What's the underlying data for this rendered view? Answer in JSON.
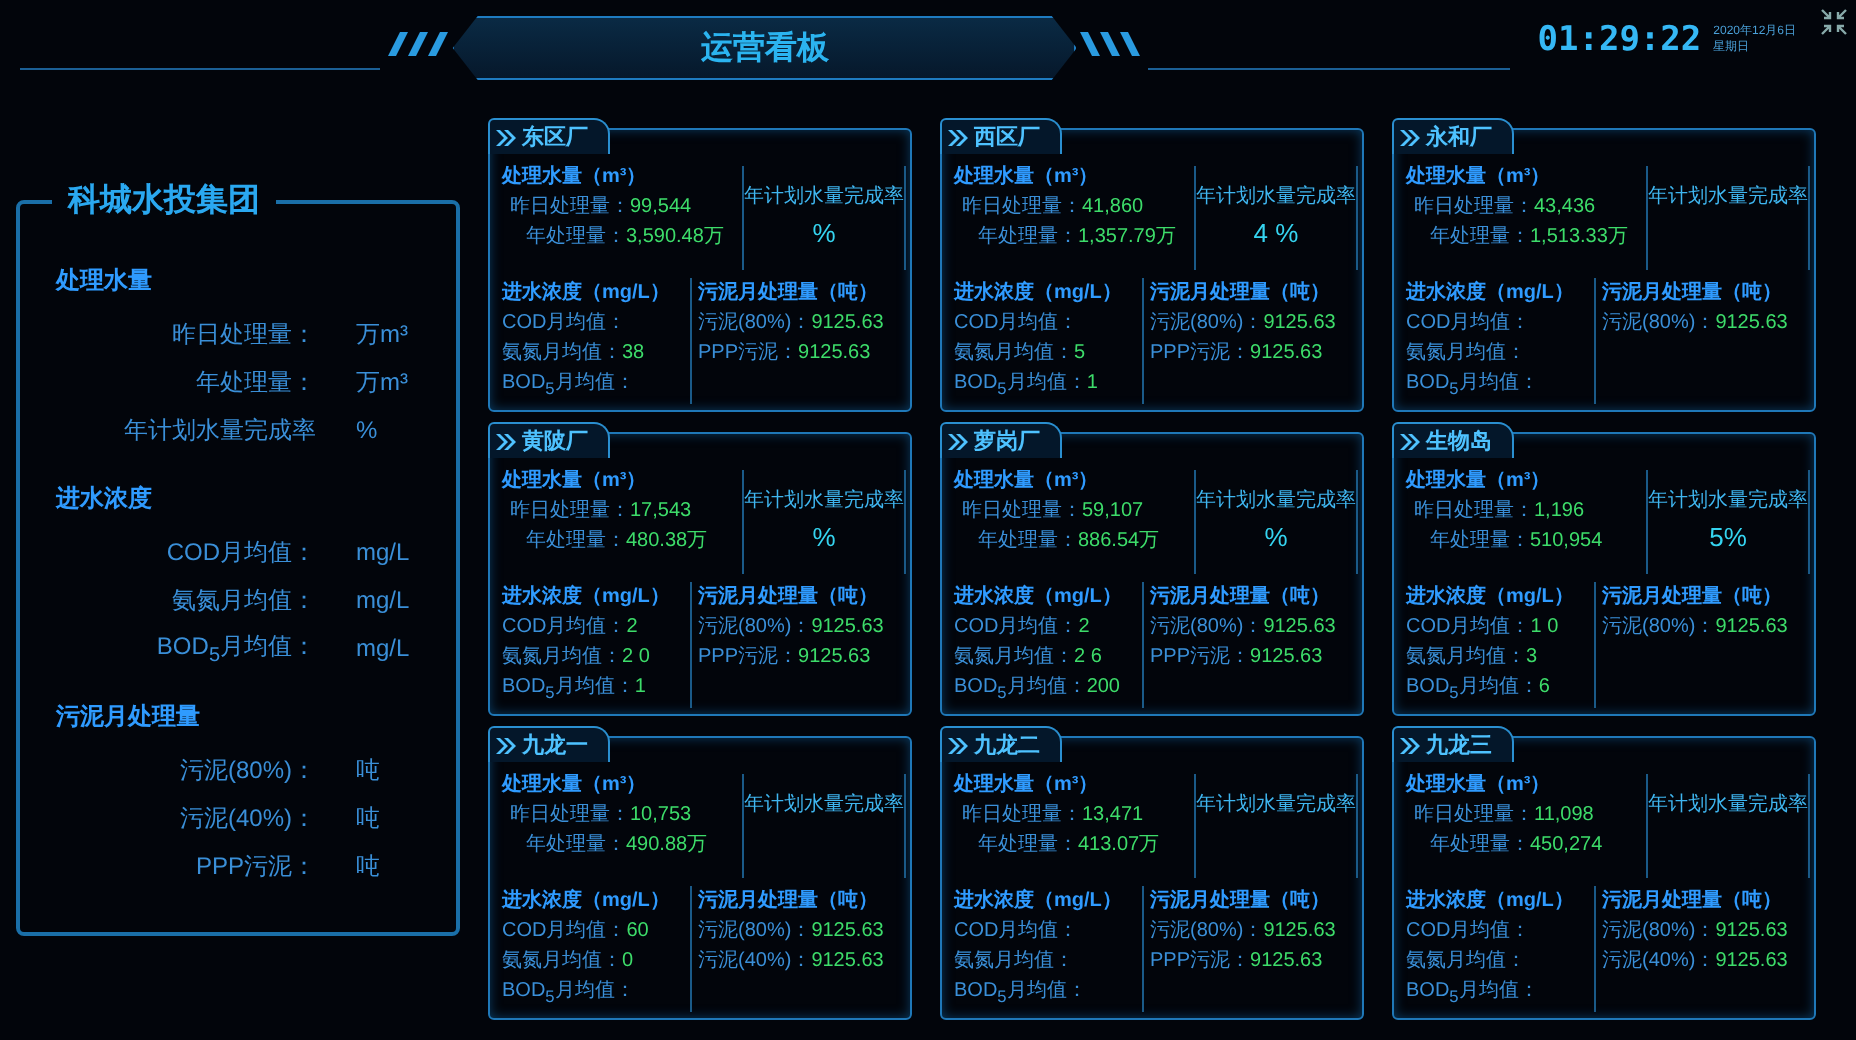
{
  "header": {
    "title": "运营看板",
    "clock": "01:29:22",
    "date": "2020年12月6日",
    "weekday": "星期日"
  },
  "summary": {
    "title": "科城水投集团",
    "sections": [
      {
        "heading": "处理水量",
        "rows": [
          {
            "label": "昨日处理量：",
            "unit": "万m³"
          },
          {
            "label": "年处理量：",
            "unit": "万m³"
          },
          {
            "label": "年计划水量完成率",
            "unit": "%"
          }
        ]
      },
      {
        "heading": "进水浓度",
        "rows": [
          {
            "label": "COD月均值：",
            "unit": "mg/L"
          },
          {
            "label": "氨氮月均值：",
            "unit": "mg/L"
          },
          {
            "label": "BOD$_{5}$月均值：",
            "unit": "mg/L"
          }
        ]
      },
      {
        "heading": "污泥月处理量",
        "rows": [
          {
            "label": "污泥(80%)：",
            "unit": "吨"
          },
          {
            "label": "污泥(40%)：",
            "unit": "吨"
          },
          {
            "label": "PPP污泥：",
            "unit": "吨"
          }
        ]
      }
    ]
  },
  "plants": [
    {
      "name": "东区厂",
      "water": {
        "heading": "处理水量（m³）",
        "rows": [
          {
            "label": "昨日处理量：",
            "value": "99,544"
          },
          {
            "label": "年处理量：",
            "value": "3,590.48万"
          }
        ]
      },
      "rate": {
        "label": "年计划水量完成率",
        "value": "%"
      },
      "conc": {
        "heading": "进水浓度（mg/L）",
        "rows": [
          {
            "label": "COD月均值："
          },
          {
            "label": "氨氮月均值：",
            "value": "38"
          },
          {
            "label": "BOD$_{5}$月均值："
          }
        ]
      },
      "sludge": {
        "heading": "污泥月处理量（吨）",
        "rows": [
          {
            "label": "污泥(80%)：",
            "value": "9125.63"
          },
          {
            "label": "PPP污泥：",
            "value": "9125.63"
          }
        ]
      }
    },
    {
      "name": "西区厂",
      "water": {
        "heading": "处理水量（m³）",
        "rows": [
          {
            "label": "昨日处理量：",
            "value": "41,860"
          },
          {
            "label": "年处理量：",
            "value": "1,357.79万"
          }
        ]
      },
      "rate": {
        "label": "年计划水量完成率",
        "value": "4 %"
      },
      "conc": {
        "heading": "进水浓度（mg/L）",
        "rows": [
          {
            "label": "COD月均值："
          },
          {
            "label": "氨氮月均值：",
            "value": "5"
          },
          {
            "label": "BOD$_{5}$月均值：",
            "value": "1"
          }
        ]
      },
      "sludge": {
        "heading": "污泥月处理量（吨）",
        "rows": [
          {
            "label": "污泥(80%)：",
            "value": "9125.63"
          },
          {
            "label": "PPP污泥：",
            "value": "9125.63"
          }
        ]
      }
    },
    {
      "name": "永和厂",
      "water": {
        "heading": "处理水量（m³）",
        "rows": [
          {
            "label": "昨日处理量：",
            "value": "43,436"
          },
          {
            "label": "年处理量：",
            "value": "1,513.33万"
          }
        ]
      },
      "rate": {
        "label": "年计划水量完成率"
      },
      "conc": {
        "heading": "进水浓度（mg/L）",
        "rows": [
          {
            "label": "COD月均值："
          },
          {
            "label": "氨氮月均值："
          },
          {
            "label": "BOD$_{5}$月均值："
          }
        ]
      },
      "sludge": {
        "heading": "污泥月处理量（吨）",
        "rows": [
          {
            "label": "污泥(80%)：",
            "value": "9125.63"
          }
        ]
      }
    },
    {
      "name": "黄陂厂",
      "water": {
        "heading": "处理水量（m³）",
        "rows": [
          {
            "label": "昨日处理量：",
            "value": "17,543"
          },
          {
            "label": "年处理量：",
            "value": "480.38万"
          }
        ]
      },
      "rate": {
        "label": "年计划水量完成率",
        "value": "%"
      },
      "conc": {
        "heading": "进水浓度（mg/L）",
        "rows": [
          {
            "label": "COD月均值：",
            "value": "2"
          },
          {
            "label": "氨氮月均值：",
            "value": "2 0"
          },
          {
            "label": "BOD$_{5}$月均值：",
            "value": "1"
          }
        ]
      },
      "sludge": {
        "heading": "污泥月处理量（吨）",
        "rows": [
          {
            "label": "污泥(80%)：",
            "value": "9125.63"
          },
          {
            "label": "PPP污泥：",
            "value": "9125.63"
          }
        ]
      }
    },
    {
      "name": "萝岗厂",
      "water": {
        "heading": "处理水量（m³）",
        "rows": [
          {
            "label": "昨日处理量：",
            "value": "59,107"
          },
          {
            "label": "年处理量：",
            "value": "886.54万"
          }
        ]
      },
      "rate": {
        "label": "年计划水量完成率",
        "value": "%"
      },
      "conc": {
        "heading": "进水浓度（mg/L）",
        "rows": [
          {
            "label": "COD月均值：",
            "value": "2"
          },
          {
            "label": "氨氮月均值：",
            "value": "2 6"
          },
          {
            "label": "BOD$_{5}$月均值：",
            "value": "200"
          }
        ]
      },
      "sludge": {
        "heading": "污泥月处理量（吨）",
        "rows": [
          {
            "label": "污泥(80%)：",
            "value": "9125.63"
          },
          {
            "label": "PPP污泥：",
            "value": "9125.63"
          }
        ]
      }
    },
    {
      "name": "生物岛",
      "water": {
        "heading": "处理水量（m³）",
        "rows": [
          {
            "label": "昨日处理量：",
            "value": "1,196"
          },
          {
            "label": "年处理量：",
            "value": "510,954"
          }
        ]
      },
      "rate": {
        "label": "年计划水量完成率",
        "value": "5%"
      },
      "conc": {
        "heading": "进水浓度（mg/L）",
        "rows": [
          {
            "label": "COD月均值：",
            "value": "1 0"
          },
          {
            "label": "氨氮月均值：",
            "value": "3"
          },
          {
            "label": "BOD$_{5}$月均值：",
            "value": "6"
          }
        ]
      },
      "sludge": {
        "heading": "污泥月处理量（吨）",
        "rows": [
          {
            "label": "污泥(80%)：",
            "value": "9125.63"
          }
        ]
      }
    },
    {
      "name": "九龙一",
      "water": {
        "heading": "处理水量（m³）",
        "rows": [
          {
            "label": "昨日处理量：",
            "value": "10,753"
          },
          {
            "label": "年处理量：",
            "value": "490.88万"
          }
        ]
      },
      "rate": {
        "label": "年计划水量完成率"
      },
      "conc": {
        "heading": "进水浓度（mg/L）",
        "rows": [
          {
            "label": "COD月均值：",
            "value": "60"
          },
          {
            "label": "氨氮月均值：",
            "value": "0"
          },
          {
            "label": "BOD$_{5}$月均值："
          }
        ]
      },
      "sludge": {
        "heading": "污泥月处理量（吨）",
        "rows": [
          {
            "label": "污泥(80%)：",
            "value": "9125.63"
          },
          {
            "label": "污泥(40%)：",
            "value": "9125.63"
          }
        ]
      }
    },
    {
      "name": "九龙二",
      "water": {
        "heading": "处理水量（m³）",
        "rows": [
          {
            "label": "昨日处理量：",
            "value": "13,471"
          },
          {
            "label": "年处理量：",
            "value": "413.07万"
          }
        ]
      },
      "rate": {
        "label": "年计划水量完成率"
      },
      "conc": {
        "heading": "进水浓度（mg/L）",
        "rows": [
          {
            "label": "COD月均值："
          },
          {
            "label": "氨氮月均值："
          },
          {
            "label": "BOD$_{5}$月均值："
          }
        ]
      },
      "sludge": {
        "heading": "污泥月处理量（吨）",
        "rows": [
          {
            "label": "污泥(80%)：",
            "value": "9125.63"
          },
          {
            "label": "PPP污泥：",
            "value": "9125.63"
          }
        ]
      }
    },
    {
      "name": "九龙三",
      "water": {
        "heading": "处理水量（m³）",
        "rows": [
          {
            "label": "昨日处理量：",
            "value": "11,098"
          },
          {
            "label": "年处理量：",
            "value": "450,274"
          }
        ]
      },
      "rate": {
        "label": "年计划水量完成率"
      },
      "conc": {
        "heading": "进水浓度（mg/L）",
        "rows": [
          {
            "label": "COD月均值："
          },
          {
            "label": "氨氮月均值："
          },
          {
            "label": "BOD$_{5}$月均值："
          }
        ]
      },
      "sludge": {
        "heading": "污泥月处理量（吨）",
        "rows": [
          {
            "label": "污泥(80%)：",
            "value": "9125.63"
          },
          {
            "label": "污泥(40%)：",
            "value": "9125.63"
          }
        ]
      }
    }
  ]
}
